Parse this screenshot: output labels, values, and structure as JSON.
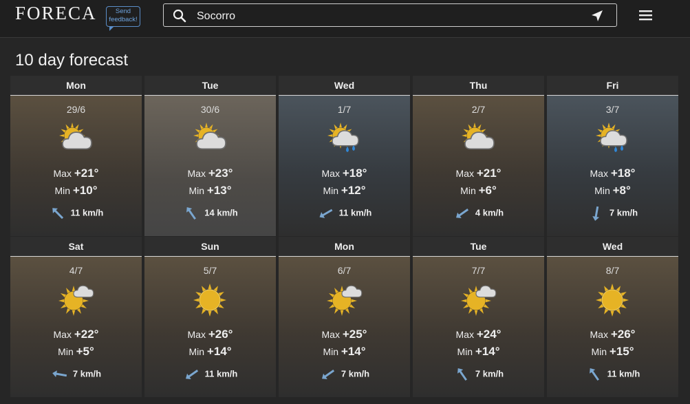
{
  "header": {
    "logo": "FORECA",
    "feedback_label": "Send feedback!",
    "search_value": "Socorro",
    "icons": [
      "search-icon",
      "location-arrow-icon",
      "hamburger-menu-icon"
    ]
  },
  "page_title": "10 day forecast",
  "colors": {
    "sun": "#e6b325",
    "rain": "#2f86d6",
    "wind_arrow": "#7aa6cf",
    "feedback": "#5b8ec9"
  },
  "days": [
    {
      "day": "Mon",
      "date": "29/6",
      "icon": "partly-cloudy",
      "max": "+21°",
      "min": "+10°",
      "wind": "11 km/h",
      "wind_dir": 225,
      "min_label": "Min",
      "max_label": "Max"
    },
    {
      "day": "Tue",
      "date": "30/6",
      "icon": "partly-cloudy",
      "max": "+23°",
      "min": "+13°",
      "wind": "14 km/h",
      "wind_dir": 235,
      "min_label": "Min",
      "max_label": "Max"
    },
    {
      "day": "Wed",
      "date": "1/7",
      "icon": "partly-cloudy-rain",
      "max": "+18°",
      "min": "+12°",
      "wind": "11 km/h",
      "wind_dir": 150,
      "min_label": "Min",
      "max_label": "Max"
    },
    {
      "day": "Thu",
      "date": "2/7",
      "icon": "partly-cloudy",
      "max": "+21°",
      "min": "+6°",
      "wind": "4 km/h",
      "wind_dir": 145,
      "min_label": "Min",
      "max_label": "Max"
    },
    {
      "day": "Fri",
      "date": "3/7",
      "icon": "partly-cloudy-rain",
      "max": "+18°",
      "min": "+8°",
      "wind": "7 km/h",
      "wind_dir": 100,
      "min_label": "Min",
      "max_label": "Max"
    },
    {
      "day": "Sat",
      "date": "4/7",
      "icon": "mostly-sunny",
      "max": "+22°",
      "min": "+5°",
      "wind": "7 km/h",
      "wind_dir": 190,
      "min_label": "Min",
      "max_label": "Max"
    },
    {
      "day": "Sun",
      "date": "5/7",
      "icon": "sunny",
      "max": "+26°",
      "min": "+14°",
      "wind": "11 km/h",
      "wind_dir": 145,
      "min_label": "Min",
      "max_label": "Max"
    },
    {
      "day": "Mon",
      "date": "6/7",
      "icon": "mostly-sunny",
      "max": "+25°",
      "min": "+14°",
      "wind": "7 km/h",
      "wind_dir": 145,
      "min_label": "Min",
      "max_label": "Max"
    },
    {
      "day": "Tue",
      "date": "7/7",
      "icon": "mostly-sunny",
      "max": "+24°",
      "min": "+14°",
      "wind": "7 km/h",
      "wind_dir": 235,
      "min_label": "Min",
      "max_label": "Max"
    },
    {
      "day": "Wed",
      "date": "8/7",
      "icon": "sunny",
      "max": "+26°",
      "min": "+15°",
      "wind": "11 km/h",
      "wind_dir": 235,
      "min_label": "Min",
      "max_label": "Max"
    }
  ]
}
